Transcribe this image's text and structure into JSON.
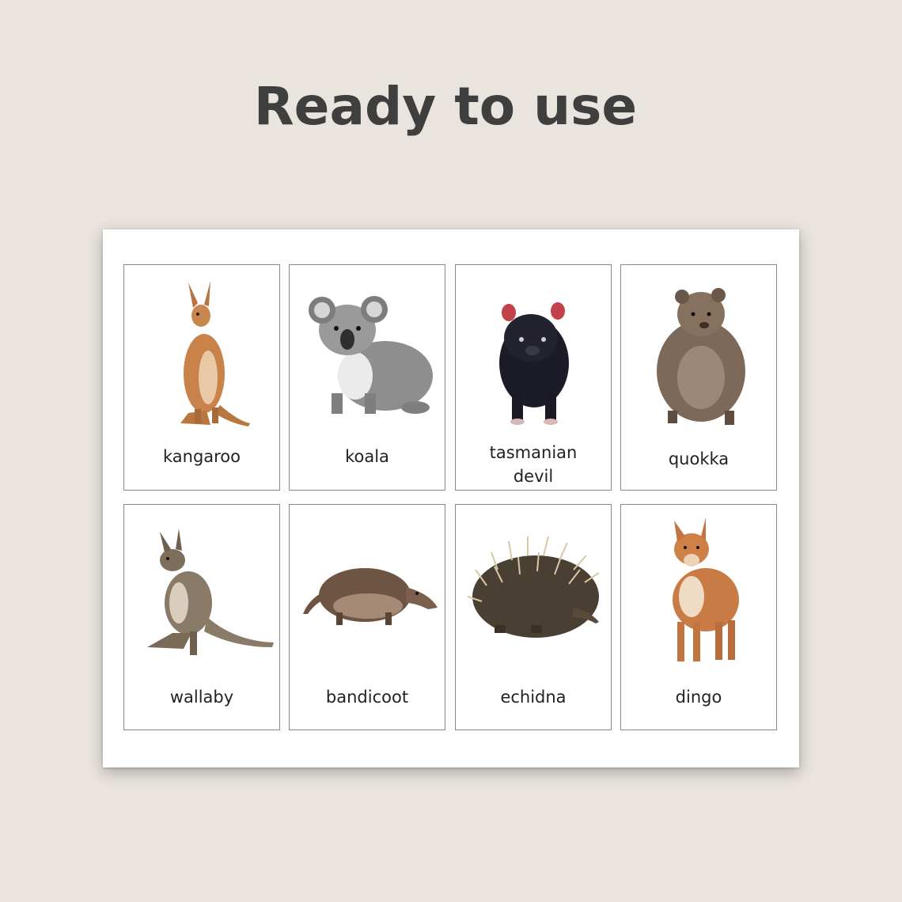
{
  "headline": "Ready to use",
  "cards": [
    {
      "label": "kangaroo",
      "icon": "kangaroo-icon"
    },
    {
      "label": "koala",
      "icon": "koala-icon"
    },
    {
      "label": "tasmanian devil",
      "line1": "tasmanian",
      "line2": "devil",
      "icon": "tasmanian-devil-icon"
    },
    {
      "label": "quokka",
      "icon": "quokka-icon"
    },
    {
      "label": "wallaby",
      "icon": "wallaby-icon"
    },
    {
      "label": "bandicoot",
      "icon": "bandicoot-icon"
    },
    {
      "label": "echidna",
      "icon": "echidna-icon"
    },
    {
      "label": "dingo",
      "icon": "dingo-icon"
    }
  ],
  "colors": {
    "background": "#e9e4dd",
    "headline": "#3f3f3f",
    "sheet": "#ffffff",
    "card_border": "#8a8a8a"
  }
}
